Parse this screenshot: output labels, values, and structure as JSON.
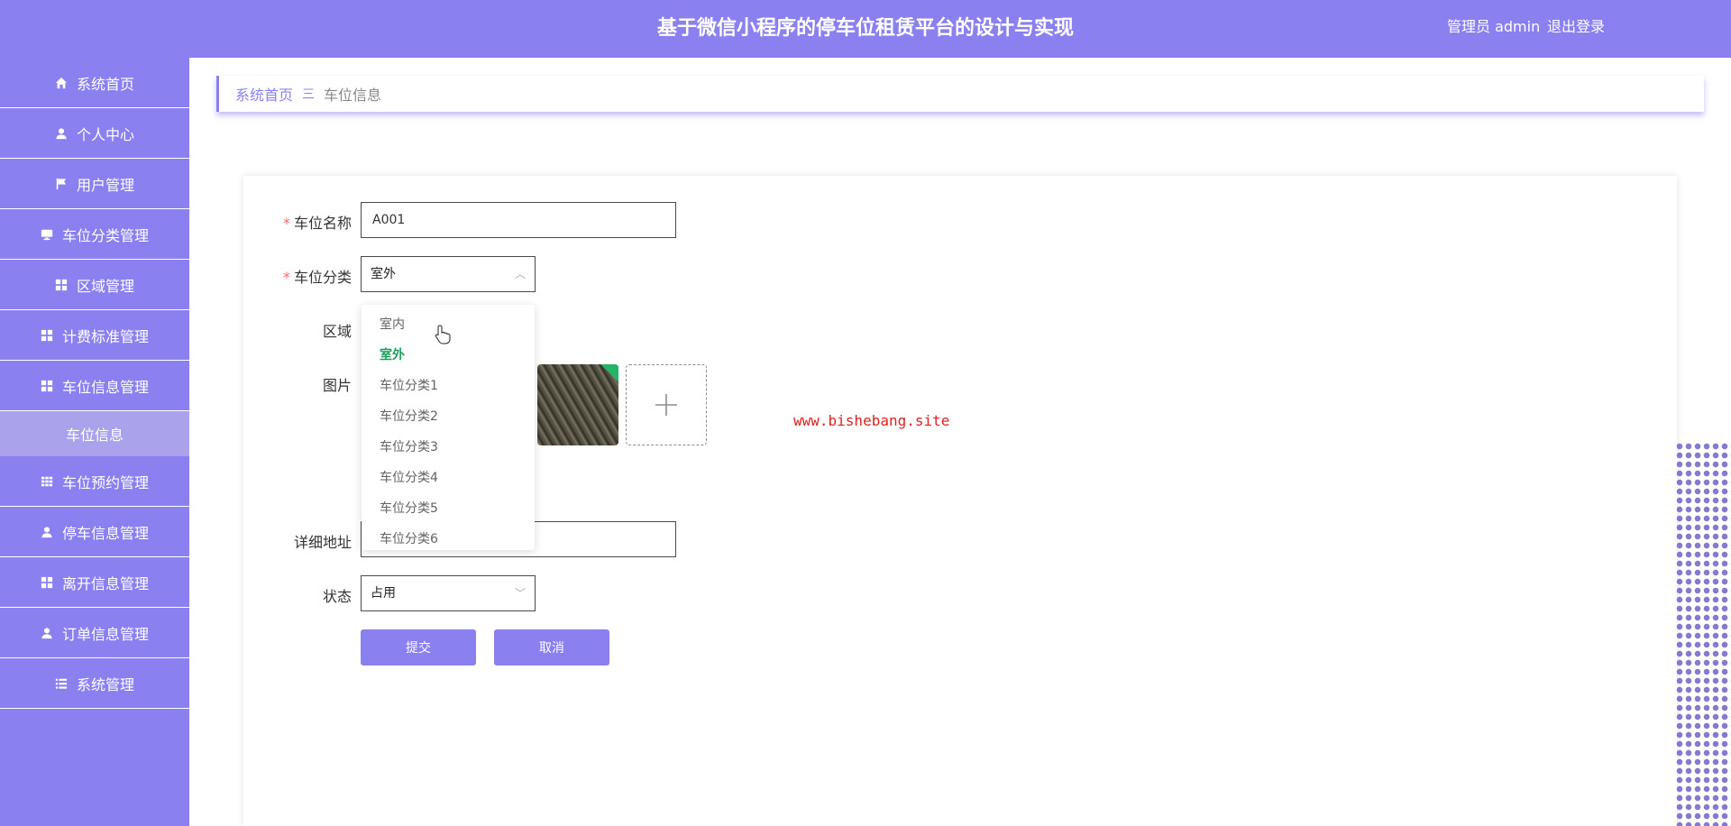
{
  "header": {
    "title": "基于微信小程序的停车位租赁平台的设计与实现",
    "user_label": "管理员 admin",
    "logout_label": "退出登录"
  },
  "sidebar": {
    "items": [
      {
        "label": "系统首页",
        "icon": "home-icon"
      },
      {
        "label": "个人中心",
        "icon": "user-icon"
      },
      {
        "label": "用户管理",
        "icon": "flag-icon"
      },
      {
        "label": "车位分类管理",
        "icon": "monitor-icon"
      },
      {
        "label": "区域管理",
        "icon": "grid-icon"
      },
      {
        "label": "计费标准管理",
        "icon": "grid-icon"
      },
      {
        "label": "车位信息管理",
        "icon": "grid-icon"
      },
      {
        "label": "车位信息",
        "icon": ""
      },
      {
        "label": "车位预约管理",
        "icon": "table-icon"
      },
      {
        "label": "停车信息管理",
        "icon": "user-icon"
      },
      {
        "label": "离开信息管理",
        "icon": "grid-icon"
      },
      {
        "label": "订单信息管理",
        "icon": "user-icon"
      },
      {
        "label": "系统管理",
        "icon": "list-icon"
      }
    ]
  },
  "breadcrumb": {
    "home": "系统首页",
    "separator": "三",
    "current": "车位信息"
  },
  "form": {
    "name_label": "车位名称",
    "name_value": "A001",
    "category_label": "车位分类",
    "category_value": "室外",
    "area_label": "区域",
    "image_label": "图片",
    "address_label": "详细地址",
    "status_label": "状态",
    "status_value": "占用",
    "submit_label": "提交",
    "cancel_label": "取消"
  },
  "category_options": [
    "室内",
    "室外",
    "车位分类1",
    "车位分类2",
    "车位分类3",
    "车位分类4",
    "车位分类5",
    "车位分类6"
  ],
  "selected_category_index": 1,
  "watermark": "www.bishebang.site",
  "colors": {
    "primary": "#8a80f0",
    "selected_option": "#19a05a",
    "watermark": "#e02020"
  }
}
